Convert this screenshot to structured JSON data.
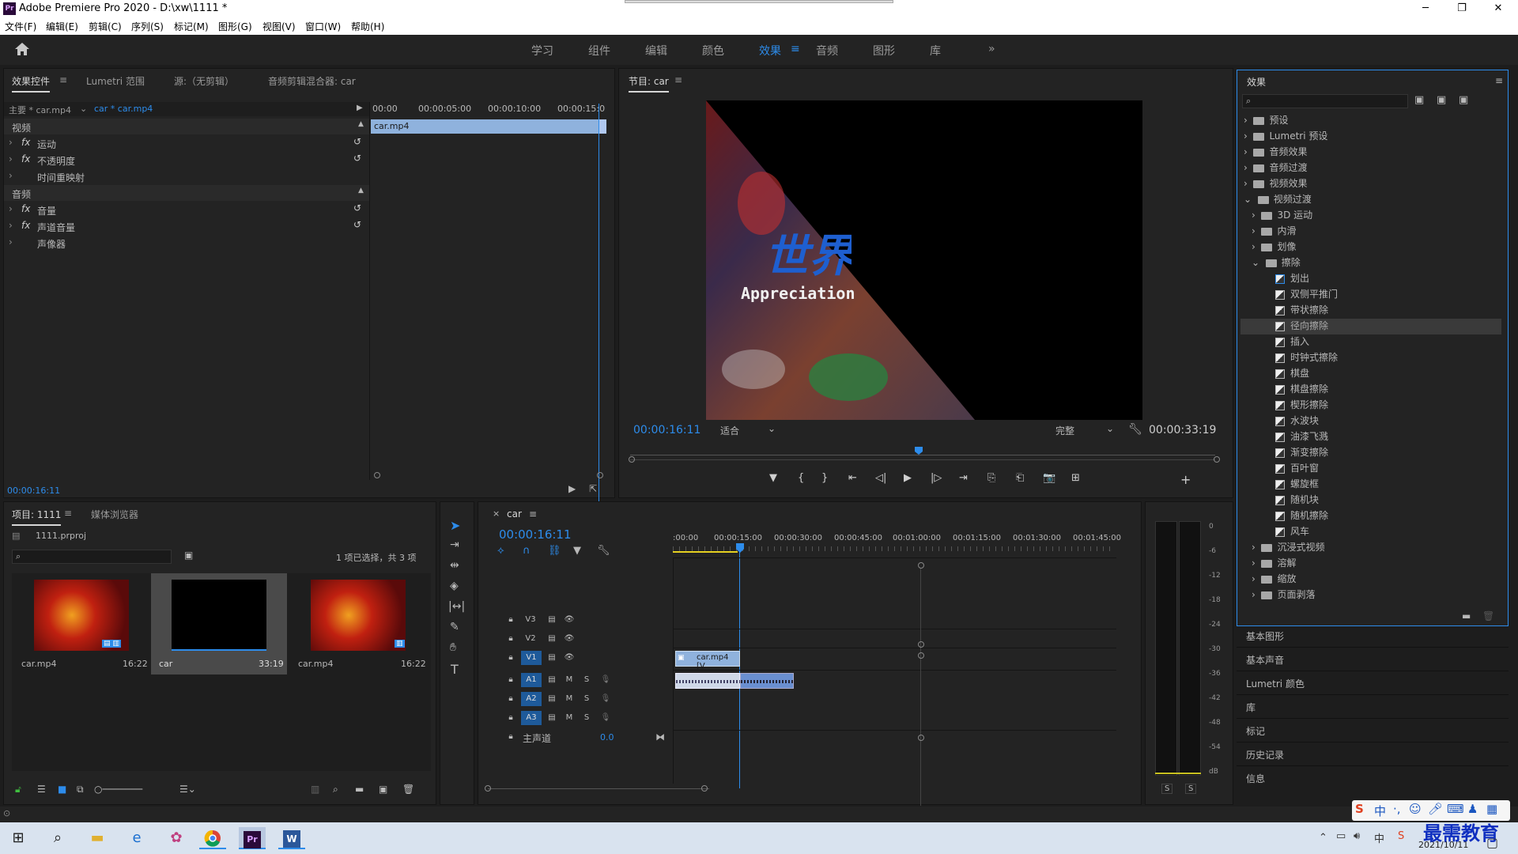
{
  "window": {
    "title": "Adobe Premiere Pro 2020 - D:\\xw\\1111 *",
    "app_icon": "Pr",
    "minimize": "─",
    "maximize": "❐",
    "close": "✕"
  },
  "menu": [
    "文件(F)",
    "编辑(E)",
    "剪辑(C)",
    "序列(S)",
    "标记(M)",
    "图形(G)",
    "视图(V)",
    "窗口(W)",
    "帮助(H)"
  ],
  "workspaces": {
    "items": [
      "学习",
      "组件",
      "编辑",
      "颜色",
      "效果",
      "音频",
      "图形",
      "库"
    ],
    "active": "效果",
    "more": "»",
    "menu_icon": "≡"
  },
  "effect_controls": {
    "tabs": [
      "效果控件",
      "Lumetri 范围",
      "源:（无剪辑）",
      "音频剪辑混合器: car"
    ],
    "tab_menu": "≡",
    "master": "主要 * car.mp4",
    "clip": "car * car.mp4",
    "ruler": [
      "00:00",
      "00:00:05:00",
      "00:00:10:00",
      "00:00:15:0"
    ],
    "clip_bar": "car.mp4",
    "sections": {
      "video": "视频",
      "audio": "音频"
    },
    "video_items": [
      "运动",
      "不透明度",
      "时间重映射"
    ],
    "audio_items": [
      "音量",
      "声道音量",
      "声像器"
    ],
    "fx": "fx",
    "timecode": "00:00:16:11"
  },
  "program_monitor": {
    "title": "节目: car",
    "menu_icon": "≡",
    "video_text_big": "世界",
    "video_text_sub": "Appreciation",
    "timecode": "00:00:16:11",
    "fit": "适合",
    "quality": "完整",
    "duration": "00:00:33:19",
    "controls": [
      "▼",
      "{",
      "}",
      "⇤",
      "◁|",
      "▶",
      "|▷",
      "⇥",
      "⎘",
      "⎗",
      "📷",
      "⊞",
      "+"
    ]
  },
  "effects_panel": {
    "title": "效果",
    "menu_icon": "≡",
    "search_placeholder": "",
    "top_items": [
      "预设",
      "Lumetri 预设",
      "音频效果",
      "音频过渡",
      "视频效果",
      "视频过渡"
    ],
    "video_transitions_children": [
      "3D 运动",
      "内滑",
      "划像",
      "擦除"
    ],
    "wipe_items": [
      "划出",
      "双侧平推门",
      "带状擦除",
      "径向擦除",
      "插入",
      "时钟式擦除",
      "棋盘",
      "棋盘擦除",
      "楔形擦除",
      "水波块",
      "油漆飞溅",
      "渐变擦除",
      "百叶窗",
      "螺旋框",
      "随机块",
      "随机擦除",
      "风车"
    ],
    "selected_wipe": "径向擦除",
    "after_items": [
      "沉浸式视频",
      "溶解",
      "缩放",
      "页面剥落"
    ],
    "collapsed_panels": [
      "基本图形",
      "基本声音",
      "Lumetri 颜色",
      "库",
      "标记",
      "历史记录",
      "信息"
    ]
  },
  "project": {
    "tabs": [
      "项目: 1111",
      "媒体浏览器"
    ],
    "tab_menu": "≡",
    "file": "1111.prproj",
    "selection": "1 项已选择，共 3 项",
    "search_placeholder": "",
    "items": [
      {
        "name": "car.mp4",
        "duration": "16:22"
      },
      {
        "name": "car",
        "duration": "33:19"
      },
      {
        "name": "car.mp4",
        "duration": "16:22"
      }
    ]
  },
  "timeline": {
    "sequence": "car",
    "close": "×",
    "menu_icon": "≡",
    "timecode": "00:00:16:11",
    "ruler": [
      ":00:00",
      "00:00:15:00",
      "00:00:30:00",
      "00:00:45:00",
      "00:01:00:00",
      "00:01:15:00",
      "00:01:30:00",
      "00:01:45:00"
    ],
    "video_tracks": [
      "V3",
      "V2",
      "V1"
    ],
    "audio_tracks": [
      "A1",
      "A2",
      "A3"
    ],
    "master": "主声道",
    "master_value": "0.0",
    "clip_label": "car.mp4 [V",
    "m": "M",
    "s": "S"
  },
  "audio_meter": {
    "scale": [
      "0",
      "-6",
      "-12",
      "-18",
      "-24",
      "-30",
      "-36",
      "-42",
      "-48",
      "-54",
      "dB"
    ],
    "solo": [
      "S",
      "S"
    ]
  },
  "taskbar": {
    "time": "",
    "date": "2021/10/11",
    "watermark": "最需教育",
    "ime": "中"
  },
  "colors": {
    "accent": "#2d8ceb",
    "panel": "#232323",
    "clip": "#8fb2dd"
  }
}
